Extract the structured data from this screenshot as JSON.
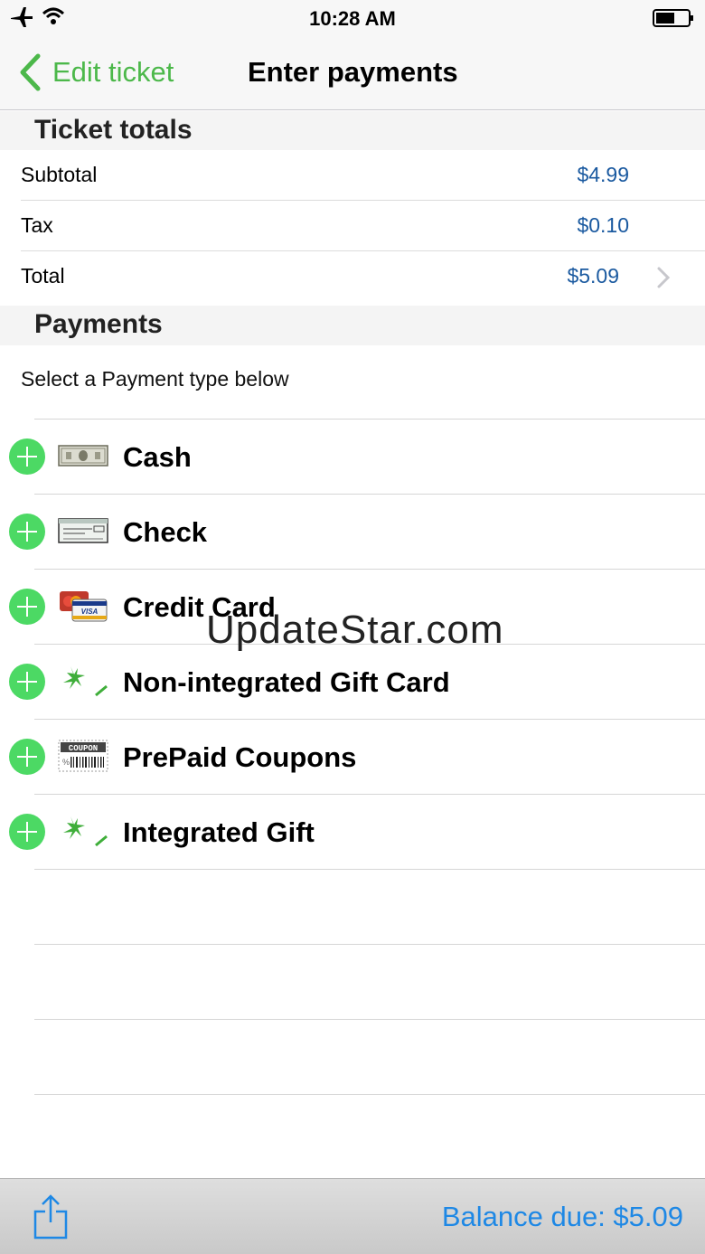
{
  "status_bar": {
    "time": "10:28 AM",
    "icons": [
      "airplane-icon",
      "wifi-icon",
      "battery-icon"
    ]
  },
  "nav": {
    "back_label": "Edit ticket",
    "title": "Enter payments"
  },
  "totals": {
    "header": "Ticket totals",
    "rows": [
      {
        "label": "Subtotal",
        "value": "$4.99"
      },
      {
        "label": "Tax",
        "value": "$0.10"
      },
      {
        "label": "Total",
        "value": "$5.09"
      }
    ]
  },
  "payments": {
    "header": "Payments",
    "hint": "Select a Payment type below",
    "types": [
      {
        "label": "Cash",
        "icon": "cash-icon"
      },
      {
        "label": "Check",
        "icon": "check-icon"
      },
      {
        "label": "Credit Card",
        "icon": "credit-card-icon"
      },
      {
        "label": "Non-integrated Gift Card",
        "icon": "gift-card-icon"
      },
      {
        "label": "PrePaid Coupons",
        "icon": "coupon-icon"
      },
      {
        "label": "Integrated Gift",
        "icon": "gift-icon"
      }
    ],
    "coupon_icon_text": "COUPON"
  },
  "watermark": "UpdateStar.com",
  "toolbar": {
    "balance": "Balance due: $5.09"
  },
  "colors": {
    "accent_green": "#4cb84a",
    "add_green": "#4cd964",
    "value_blue": "#1b5aa0",
    "balance_blue": "#1e88e5"
  }
}
